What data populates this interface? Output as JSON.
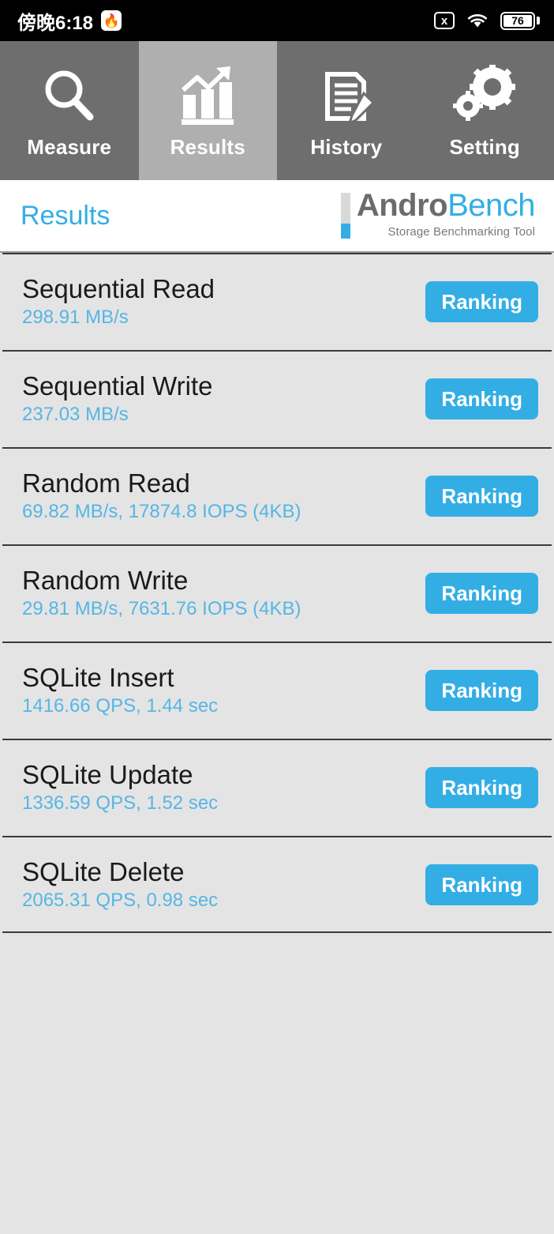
{
  "statusbar": {
    "clock": "傍晚6:18",
    "app_icon": "flame-app-icon",
    "sim_icon_label": "x",
    "wifi_icon": "wifi-icon",
    "battery_level": "76"
  },
  "tabs": [
    {
      "label": "Measure",
      "icon": "magnifier-icon",
      "active": false
    },
    {
      "label": "Results",
      "icon": "bar-chart-arrow-icon",
      "active": true
    },
    {
      "label": "History",
      "icon": "document-pencil-icon",
      "active": false
    },
    {
      "label": "Setting",
      "icon": "gears-icon",
      "active": false
    }
  ],
  "header": {
    "title": "Results",
    "logo_primary": "Andro",
    "logo_secondary": "Bench",
    "logo_tagline": "Storage Benchmarking Tool"
  },
  "results": [
    {
      "title": "Sequential Read",
      "value": "298.91 MB/s",
      "button": "Ranking"
    },
    {
      "title": "Sequential Write",
      "value": "237.03 MB/s",
      "button": "Ranking"
    },
    {
      "title": "Random Read",
      "value": "69.82 MB/s, 17874.8 IOPS (4KB)",
      "button": "Ranking"
    },
    {
      "title": "Random Write",
      "value": "29.81 MB/s, 7631.76 IOPS (4KB)",
      "button": "Ranking"
    },
    {
      "title": "SQLite Insert",
      "value": "1416.66 QPS, 1.44 sec",
      "button": "Ranking"
    },
    {
      "title": "SQLite Update",
      "value": "1336.59 QPS, 1.52 sec",
      "button": "Ranking"
    },
    {
      "title": "SQLite Delete",
      "value": "2065.31 QPS, 0.98 sec",
      "button": "Ranking"
    }
  ],
  "colors": {
    "accent_blue": "#33AEE5",
    "value_blue": "#55B6E5",
    "tab_inactive": "#6E6E6E",
    "tab_active": "#AFAFAF",
    "list_bg": "#E4E4E4",
    "status_bg": "#000000"
  }
}
